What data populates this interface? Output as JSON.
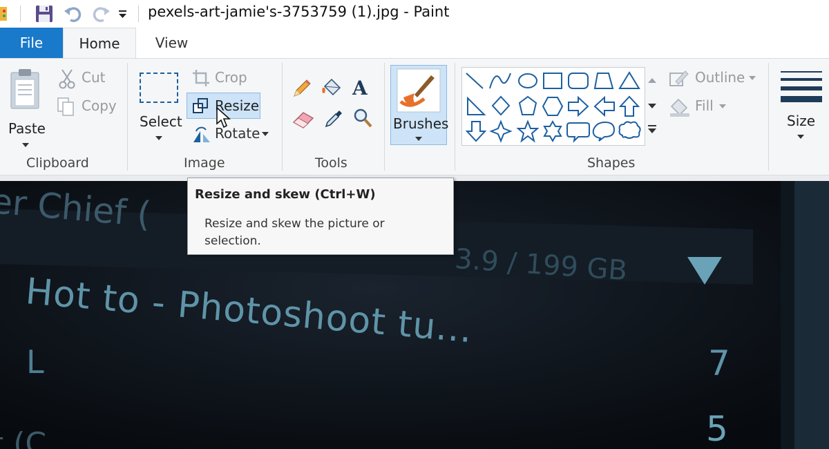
{
  "window": {
    "title": "pexels-art-jamie's-3753759 (1).jpg - Paint"
  },
  "tabs": [
    {
      "label": "File"
    },
    {
      "label": "Home"
    },
    {
      "label": "View"
    }
  ],
  "clipboard": {
    "group_label": "Clipboard",
    "paste_label": "Paste",
    "cut_label": "Cut",
    "copy_label": "Copy"
  },
  "image": {
    "group_label": "Image",
    "select_label": "Select",
    "crop_label": "Crop",
    "resize_label": "Resize",
    "rotate_label": "Rotate"
  },
  "tools": {
    "group_label": "Tools"
  },
  "brushes": {
    "label": "Brushes"
  },
  "shapes": {
    "group_label": "Shapes",
    "outline_label": "Outline",
    "fill_label": "Fill"
  },
  "size": {
    "label": "Size"
  },
  "tooltip": {
    "title": "Resize and skew (Ctrl+W)",
    "description": "Resize and skew the picture or selection."
  },
  "canvas_text": {
    "line1": "er Chief (",
    "line2": "3.9 / 199 GB",
    "line3": "Hot to - Photoshoot tu...",
    "line4": "L",
    "num1": "7",
    "num2": "5",
    "line5": "t (C"
  },
  "colors": {
    "accent": "#1979ca",
    "ribbon_bg": "#f5f6f7",
    "shape_stroke": "#1b5fa0",
    "canvas_bg": "#0d1219",
    "canvas_text": "#5f94a8"
  }
}
